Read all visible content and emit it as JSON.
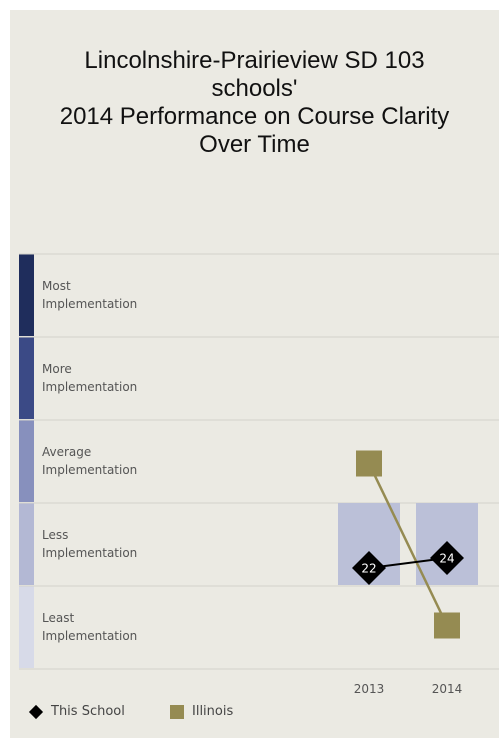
{
  "chart_data": {
    "type": "line",
    "title_lines": [
      "Lincolnshire-Prairieview SD 103",
      "schools'",
      "2014 Performance on Course Clarity",
      "Over Time"
    ],
    "bands": [
      {
        "label": "Most\nImplementation",
        "color": "#1f2d5c"
      },
      {
        "label": "More\nImplementation",
        "color": "#3b4a86"
      },
      {
        "label": "Average\nImplementation",
        "color": "#8790bd"
      },
      {
        "label": "Less\nImplementation",
        "color": "#b3b8d4"
      },
      {
        "label": "Least\nImplementation",
        "color": "#d7dae8"
      }
    ],
    "x": [
      "2013",
      "2014"
    ],
    "series": [
      {
        "name": "This School",
        "marker": "diamond",
        "color": "#000000",
        "values": [
          22,
          24
        ],
        "value_labels": [
          "22",
          "24"
        ],
        "bands_index": [
          3,
          3
        ]
      },
      {
        "name": "Illinois",
        "marker": "square",
        "color": "#958b52",
        "bands_index": [
          2,
          4
        ]
      }
    ],
    "column_bars": [
      {
        "x": "2013",
        "band": "Less Implementation",
        "color": "#bbc0d8"
      },
      {
        "x": "2014",
        "band": "Less Implementation",
        "color": "#bbc0d8"
      }
    ]
  }
}
